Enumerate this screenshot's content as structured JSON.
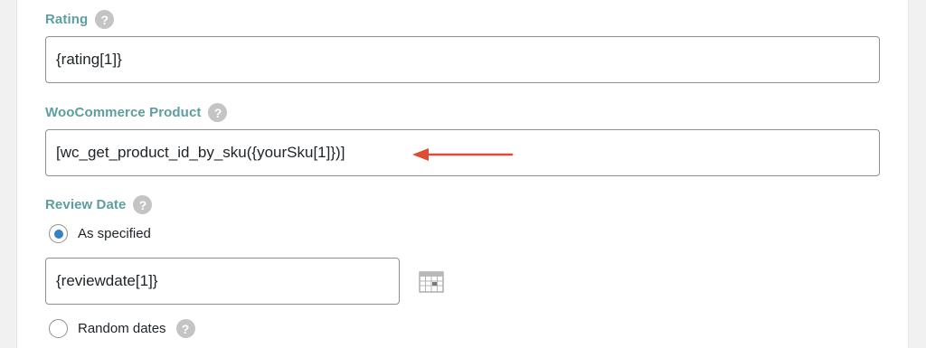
{
  "rating": {
    "label": "Rating",
    "help_icon": "question-circle-icon",
    "help_glyph": "?",
    "value": "{rating[1]}"
  },
  "product": {
    "label": "WooCommerce Product",
    "help_glyph": "?",
    "value": "[wc_get_product_id_by_sku({yourSku[1]})]",
    "annotation_color": "#e04b33"
  },
  "review_date": {
    "label": "Review Date",
    "help_glyph": "?",
    "options": [
      {
        "label": "As specified",
        "selected": true
      },
      {
        "label": "Random dates",
        "selected": false
      }
    ],
    "value": "{reviewdate[1]}",
    "calendar_icon": "calendar-icon"
  },
  "colors": {
    "label": "#5d9ea1",
    "radio_selected": "#3582c4",
    "help_icon_bg": "#c4c4c4"
  }
}
